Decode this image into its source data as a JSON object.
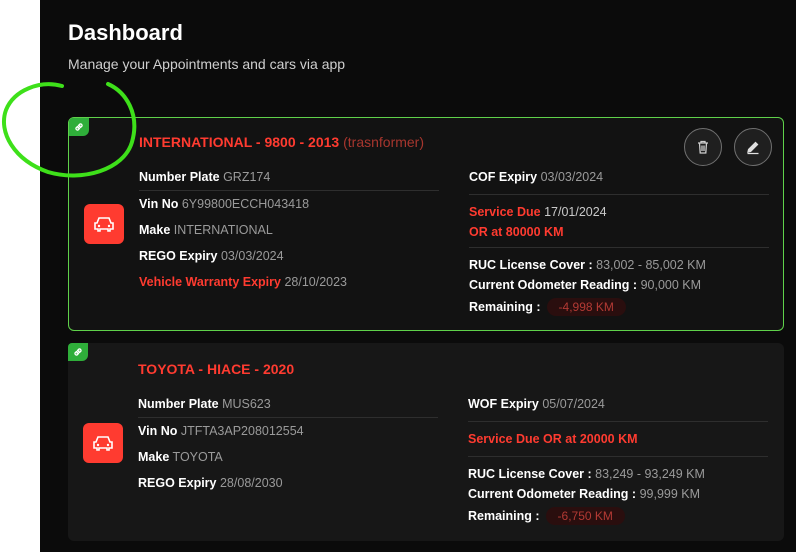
{
  "page": {
    "title": "Dashboard",
    "subtitle": "Manage your Appointments and cars via app"
  },
  "colors": {
    "accent": "#ff3b30",
    "linked_border": "#5fd14a",
    "badge": "#2fae3a"
  },
  "vehicles": [
    {
      "title": "INTERNATIONAL - 9800 - 2013",
      "variant": "(trasnformer)",
      "left": [
        {
          "label": "Number Plate",
          "value": "GRZ174"
        },
        {
          "label": "Vin No",
          "value": "6Y99800ECCH043418"
        },
        {
          "label": "Make",
          "value": "INTERNATIONAL"
        },
        {
          "label": "REGO Expiry",
          "value": "03/03/2024"
        },
        {
          "label": "Vehicle Warranty Expiry",
          "value": "28/10/2023"
        }
      ],
      "right": {
        "cert_label": "COF Expiry",
        "cert_value": "03/03/2024",
        "service_label": "Service Due",
        "service_value": "17/01/2024",
        "service_or": "OR at 80000 KM",
        "ruc_label": "RUC License Cover :",
        "ruc_value": "83,002 - 85,002 KM",
        "odo_label": "Current Odometer Reading :",
        "odo_value": "90,000 KM",
        "remaining_label": "Remaining :",
        "remaining_value": "-4,998 KM"
      }
    },
    {
      "title": "TOYOTA - HIACE - 2020",
      "left": [
        {
          "label": "Number Plate",
          "value": "MUS623"
        },
        {
          "label": "Vin No",
          "value": "JTFTA3AP208012554"
        },
        {
          "label": "Make",
          "value": "TOYOTA"
        },
        {
          "label": "REGO Expiry",
          "value": "28/08/2030"
        }
      ],
      "right": {
        "cert_label": "WOF Expiry",
        "cert_value": "05/07/2024",
        "service_label": "Service Due OR at 20000 KM",
        "ruc_label": "RUC License Cover :",
        "ruc_value": "83,249 - 93,249 KM",
        "odo_label": "Current Odometer Reading :",
        "odo_value": "99,999 KM",
        "remaining_label": "Remaining :",
        "remaining_value": "-6,750 KM"
      }
    }
  ],
  "icons": {
    "link": "link-icon",
    "car": "car-icon",
    "delete": "trash-icon",
    "edit": "pencil-icon"
  }
}
